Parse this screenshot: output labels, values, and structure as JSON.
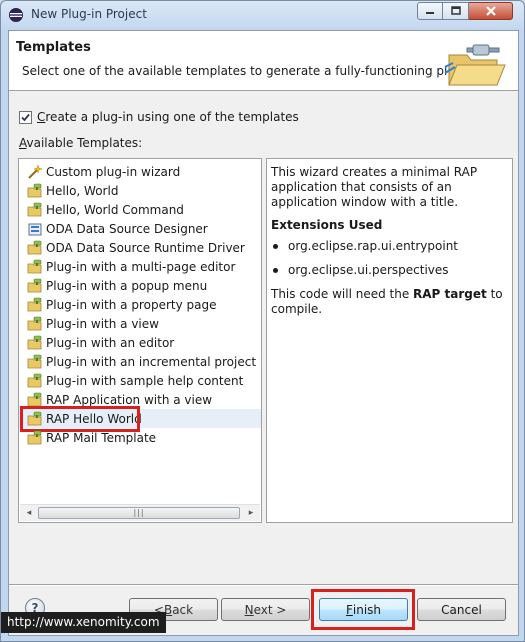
{
  "window": {
    "title": "New Plug-in Project",
    "icons": [
      "eclipse-icon",
      "minimize-icon",
      "maximize-icon",
      "close-icon"
    ]
  },
  "banner": {
    "title": "Templates",
    "description": "Select one of the available templates to generate a fully-functioning plug-in.",
    "icon": "folder-plug-wizard-icon"
  },
  "options": {
    "create_from_template_label_mnemonic": "C",
    "create_from_template_label_rest": "reate a plug-in using one of the templates",
    "create_from_template_checked": true,
    "available_label_mnemonic": "A",
    "available_label_rest": "vailable Templates:"
  },
  "templates": [
    {
      "label": "Custom plug-in wizard",
      "icon": "wand-icon"
    },
    {
      "label": "Hello, World",
      "icon": "plugin-template-icon"
    },
    {
      "label": "Hello, World Command",
      "icon": "plugin-template-icon"
    },
    {
      "label": "ODA Data Source Designer",
      "icon": "oda-icon"
    },
    {
      "label": "ODA Data Source Runtime Driver",
      "icon": "plugin-template-icon"
    },
    {
      "label": "Plug-in with a multi-page editor",
      "icon": "plugin-template-icon"
    },
    {
      "label": "Plug-in with a popup menu",
      "icon": "plugin-template-icon"
    },
    {
      "label": "Plug-in with a property page",
      "icon": "plugin-template-icon"
    },
    {
      "label": "Plug-in with a view",
      "icon": "plugin-template-icon"
    },
    {
      "label": "Plug-in with an editor",
      "icon": "plugin-template-icon"
    },
    {
      "label": "Plug-in with an incremental project build",
      "icon": "plugin-template-icon"
    },
    {
      "label": "Plug-in with sample help content",
      "icon": "plugin-template-icon"
    },
    {
      "label": "RAP Application with a view",
      "icon": "plugin-template-icon"
    },
    {
      "label": "RAP Hello World",
      "icon": "plugin-template-icon",
      "selected": true
    },
    {
      "label": "RAP Mail Template",
      "icon": "plugin-template-icon"
    }
  ],
  "description": {
    "intro": "This wizard creates a minimal RAP application that consists of an application window with a title.",
    "extensions_heading": "Extensions Used",
    "extensions": [
      "org.eclipse.rap.ui.entrypoint",
      "org.eclipse.ui.perspectives"
    ],
    "note_prefix": "This code will need the ",
    "note_bold": "RAP target",
    "note_suffix": " to compile."
  },
  "buttons": {
    "help": "?",
    "back_pre": "< ",
    "back_mnemonic": "B",
    "back_rest": "ack",
    "next_mnemonic": "N",
    "next_rest": "ext >",
    "finish_mnemonic": "F",
    "finish_rest": "inish",
    "cancel": "Cancel"
  },
  "scrollbar": {
    "grip": "|||",
    "left_arrow": "◂",
    "right_arrow": "▸"
  },
  "watermark": "http://www.xenomity.com",
  "colors": {
    "highlight": "#d8211e",
    "selection": "#e6eef8"
  }
}
